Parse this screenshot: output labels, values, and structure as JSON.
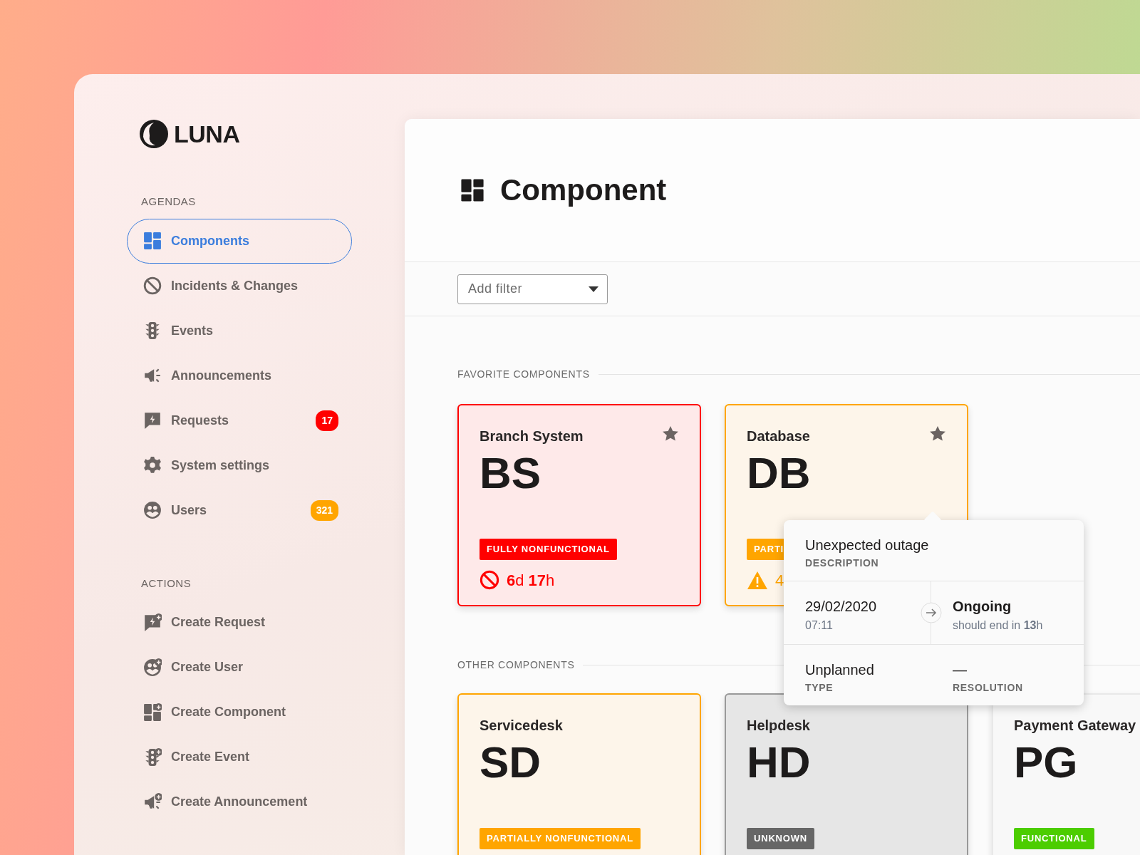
{
  "brand": {
    "name": "LUNA"
  },
  "sidebar": {
    "sections": [
      {
        "title": "AGENDAS",
        "items": [
          {
            "label": "Components",
            "selected": true
          },
          {
            "label": "Incidents & Changes",
            "selected": false
          },
          {
            "label": "Events",
            "selected": false
          },
          {
            "label": "Announcements",
            "selected": false
          },
          {
            "label": "Requests",
            "selected": false,
            "badge": {
              "text": "17",
              "color": "#ff0000"
            }
          },
          {
            "label": "System settings",
            "selected": false
          },
          {
            "label": "Users",
            "selected": false,
            "badge": {
              "text": "321",
              "color": "#ffa500"
            }
          }
        ]
      },
      {
        "title": "ACTIONS",
        "items": [
          {
            "label": "Create Request",
            "selected": false
          },
          {
            "label": "Create User",
            "selected": false
          },
          {
            "label": "Create Component",
            "selected": false
          },
          {
            "label": "Create Event",
            "selected": false
          },
          {
            "label": "Create Announcement",
            "selected": false
          }
        ]
      }
    ]
  },
  "page": {
    "title": "Component"
  },
  "filter": {
    "placeholder": "Add filter"
  },
  "groups": [
    {
      "title": "FAVORITE COMPONENTS",
      "cards": [
        {
          "name": "Branch System",
          "abbr": "BS",
          "favorite": true,
          "status": {
            "kind": "down",
            "label": "FULLY NONFUNCTIONAL"
          },
          "duration": "**6**d **17**h"
        },
        {
          "name": "Database",
          "abbr": "DB",
          "favorite": true,
          "status": {
            "kind": "partial",
            "label": "PARTI"
          },
          "duration": "4"
        }
      ]
    },
    {
      "title": "OTHER COMPONENTS",
      "cards": [
        {
          "name": "Servicedesk",
          "abbr": "SD",
          "favorite": false,
          "status": {
            "kind": "partial",
            "label": "PARTIALLY NONFUNCTIONAL"
          }
        },
        {
          "name": "Helpdesk",
          "abbr": "HD",
          "favorite": false,
          "status": {
            "kind": "unknown",
            "label": "UNKNOWN"
          }
        },
        {
          "name": "Payment Gateway",
          "abbr": "PG",
          "favorite": false,
          "status": {
            "kind": "functional",
            "label": "FUNCTIONAL"
          }
        }
      ]
    }
  ],
  "popover": {
    "description": "Unexpected outage",
    "description_label": "DESCRIPTION",
    "start_date": "29/02/2020",
    "start_time": "07:11",
    "state": "Ongoing",
    "state_note": "should end in **13**h",
    "type": "Unplanned",
    "type_label": "TYPE",
    "resolution": "—",
    "resolution_label": "RESOLUTION"
  }
}
